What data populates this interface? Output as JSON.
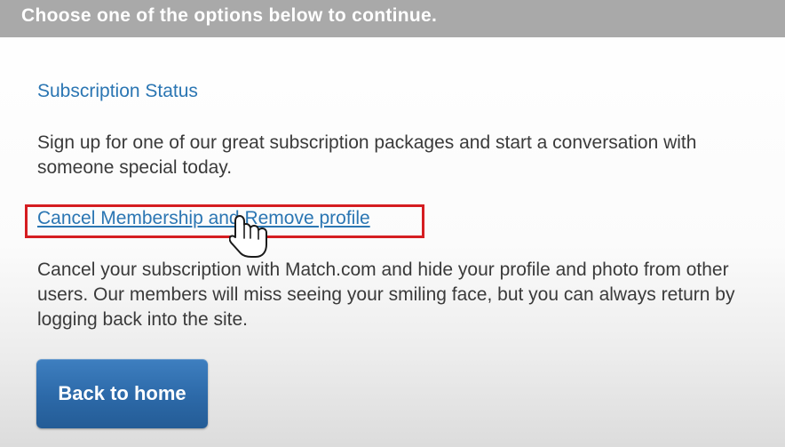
{
  "header": {
    "title": "Choose one of the options below to continue."
  },
  "subscription": {
    "title": "Subscription Status",
    "description": "Sign up for one of our great subscription packages and start a conversation with someone special today."
  },
  "cancel": {
    "link_label": "Cancel Membership and Remove profile",
    "description": "Cancel your subscription with Match.com and hide your profile and photo from other users. Our members will miss seeing your smiling face, but you can always return by logging back into the site."
  },
  "actions": {
    "home_label": "Back to home"
  },
  "icons": {
    "cursor": "hand-pointer-icon"
  },
  "colors": {
    "header_bg": "#a9a9a9",
    "link": "#2b76b3",
    "highlight": "#d51d21",
    "button": "#2c69a8"
  }
}
